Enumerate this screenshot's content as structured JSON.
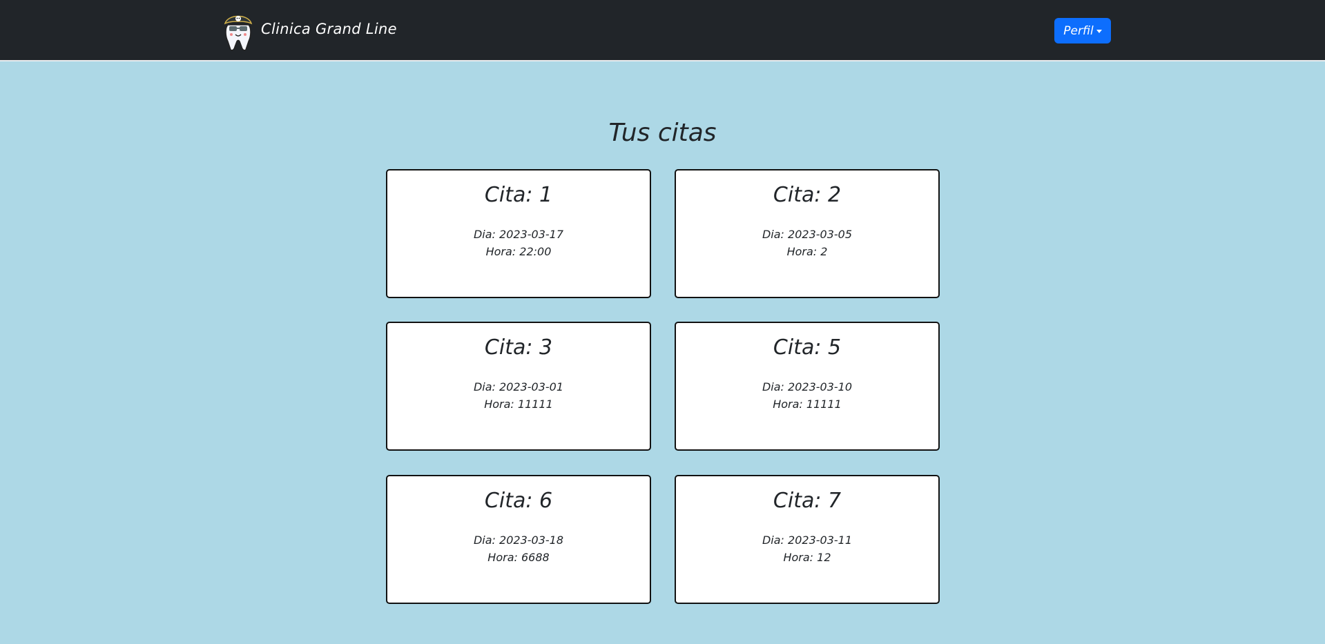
{
  "navbar": {
    "brand": "Clinica Grand Line",
    "logo_icon": "pirate-tooth-logo",
    "profile_button": "Perfil"
  },
  "colors": {
    "navbar_bg": "#212529",
    "page_bg": "#add8e6",
    "primary": "#0d6efd"
  },
  "page_title": "Tus citas",
  "appointments": [
    {
      "title": "Cita: 1",
      "dia": "Dia: 2023-03-17",
      "hora": "Hora: 22:00"
    },
    {
      "title": "Cita: 2",
      "dia": "Dia: 2023-03-05",
      "hora": "Hora: 2"
    },
    {
      "title": "Cita: 3",
      "dia": "Dia: 2023-03-01",
      "hora": "Hora: 11111"
    },
    {
      "title": "Cita: 5",
      "dia": "Dia: 2023-03-10",
      "hora": "Hora: 11111"
    },
    {
      "title": "Cita: 6",
      "dia": "Dia: 2023-03-18",
      "hora": "Hora: 6688"
    },
    {
      "title": "Cita: 7",
      "dia": "Dia: 2023-03-11",
      "hora": "Hora: 12"
    }
  ]
}
